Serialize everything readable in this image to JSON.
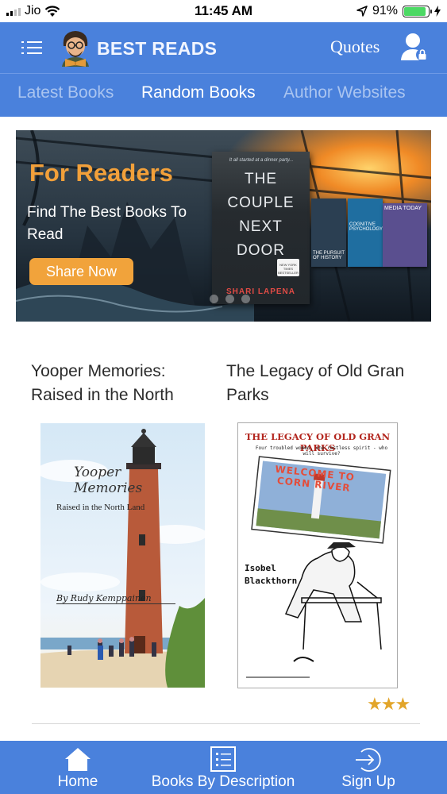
{
  "status_bar": {
    "carrier": "Jio",
    "time": "11:45 AM",
    "battery_percent": "91%",
    "battery_level": 0.91,
    "icons": [
      "signal-icon",
      "wifi-icon",
      "location-arrow-icon",
      "battery-icon",
      "charging-icon"
    ]
  },
  "header": {
    "title": "BEST READS",
    "quotes_label": "Quotes",
    "colors": {
      "primary": "#4a81dc",
      "accent": "#f1a33b"
    }
  },
  "tabs": [
    {
      "label": "Latest Books",
      "active": false
    },
    {
      "label": "Random Books",
      "active": true
    },
    {
      "label": "Author Websites",
      "active": false
    }
  ],
  "banner": {
    "title": "For Readers",
    "subtitle": "Find The Best Books To Read",
    "button_label": "Share Now",
    "slide_count": 3,
    "featured_book": {
      "tagline": "It all started at a dinner party...",
      "title_lines": [
        "THE",
        "COUPLE",
        "NEXT",
        "DOOR"
      ],
      "author": "SHARI LAPENA",
      "seal": "NEW YORK TIMES BESTSELLER"
    },
    "side_books": [
      "THE PURSUIT OF HISTORY",
      "COGNITIVE PSYCHOLOGY",
      "MEDIA TODAY"
    ]
  },
  "books": [
    {
      "title": "Yooper Memories: Raised in the North",
      "cover_title_lines": [
        "Yooper",
        "Memories"
      ],
      "cover_subtitle": "Raised in the North Land",
      "cover_author": "By Rudy Kemppainen"
    },
    {
      "title": "The Legacy of Old Gran Parks",
      "cover_title": "THE LEGACY OF OLD GRAN PARKS",
      "cover_tagline": "Four troubled women, one restless spirit - who will survive?",
      "cover_postcard": "WELCOME TO CORN RIVER",
      "cover_author_lines": [
        "Isobel",
        "Blackthorn"
      ],
      "rating": 3
    }
  ],
  "bottom_nav": [
    {
      "label": "Home",
      "icon": "home-icon"
    },
    {
      "label": "Books By Description",
      "icon": "list-icon"
    },
    {
      "label": "Sign Up",
      "icon": "sign-in-icon"
    }
  ]
}
